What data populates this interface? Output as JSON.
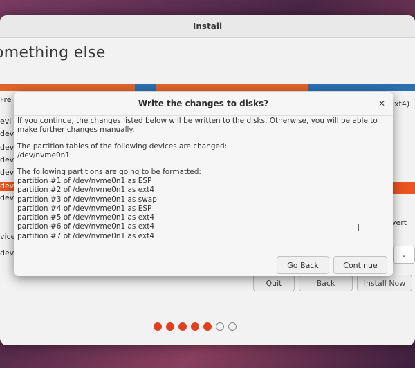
{
  "window": {
    "title": "Install"
  },
  "installer": {
    "heading": "omething else",
    "left_fragments": [
      "Fre",
      "evi",
      "dev",
      "dev",
      "dev",
      "dev",
      "dev",
      "dev",
      "vice",
      "dev"
    ],
    "right_fragment_top": "xt4)",
    "right_fragment_mid": "vert",
    "buttons": {
      "quit": "Quit",
      "back": "Back",
      "install_now": "Install Now"
    },
    "steps": {
      "total": 7,
      "completed": 5
    }
  },
  "dialog": {
    "title": "Write the changes to disks?",
    "intro": "If you continue, the changes listed below will be written to the disks. Otherwise, you will be able to make further changes manually.",
    "tables_header": "The partition tables of the following devices are changed:",
    "tables_device": "/dev/nvme0n1",
    "format_header": "The following partitions are going to be formatted:",
    "partitions": [
      "partition #1 of /dev/nvme0n1 as ESP",
      "partition #2 of /dev/nvme0n1 as ext4",
      "partition #3 of /dev/nvme0n1 as swap",
      "partition #4 of /dev/nvme0n1 as ESP",
      "partition #5 of /dev/nvme0n1 as ext4",
      "partition #6 of /dev/nvme0n1 as ext4",
      "partition #7 of /dev/nvme0n1 as ext4"
    ],
    "buttons": {
      "go_back": "Go Back",
      "continue": "Continue"
    }
  },
  "colors": {
    "accent": "#e95420",
    "partition_blue": "#2c6fb0",
    "dot_active": "#e0401f"
  }
}
